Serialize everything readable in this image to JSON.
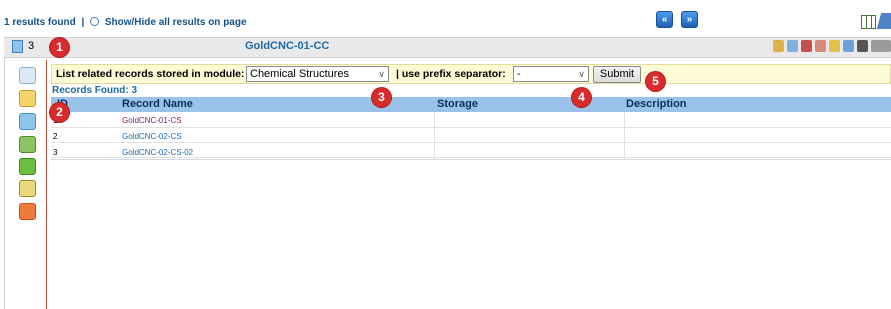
{
  "topbar": {
    "results_count": "1 results found",
    "separator": "|",
    "show_hide_label": "Show/Hide all results on page",
    "nav_prev_icon": "double-left-arrow-icon",
    "nav_next_icon": "double-right-arrow-icon"
  },
  "record_header": {
    "count": "3",
    "title": "GoldCNC-01-CC",
    "toolbar_icons": [
      "edit-icon",
      "copy-icon",
      "report-icon",
      "export-icon",
      "folder-icon",
      "print-icon",
      "grid-icon",
      "settings-icon"
    ]
  },
  "sidebar": {
    "icons": [
      "search-record-icon",
      "comment-icon",
      "link-icon",
      "move-icon",
      "download-icon",
      "preview-icon",
      "pdf-icon"
    ]
  },
  "form": {
    "module_label": "List related records stored in module:",
    "module_value": "Chemical Structures",
    "prefix_label": "| use prefix separator:",
    "prefix_value": "-",
    "submit_label": "Submit"
  },
  "records_found": "Records Found: 3",
  "table": {
    "headers": [
      "ID",
      "Record Name",
      "Storage",
      "Description"
    ],
    "rows": [
      {
        "id": "1",
        "name": "GoldCNC-01-CS",
        "storage": "",
        "description": ""
      },
      {
        "id": "2",
        "name": "GoldCNC-02-CS",
        "storage": "",
        "description": ""
      },
      {
        "id": "3",
        "name": "GoldCNC-02-CS-02",
        "storage": "",
        "description": ""
      }
    ]
  },
  "badges": [
    "1",
    "2",
    "3",
    "4",
    "5"
  ],
  "colors": {
    "badge": "#d92b2b",
    "header_bar": "#9bc3ea",
    "form_bar": "#fdfbd5",
    "link": "#1d6aa5",
    "visited_link": "#7a1e6e"
  }
}
